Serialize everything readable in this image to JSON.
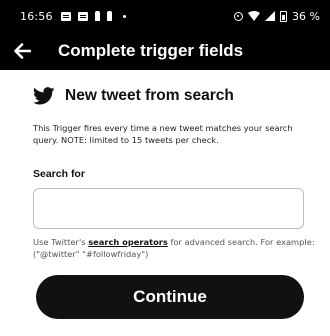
{
  "status_bar": {
    "time": "16:56",
    "battery": "36 %",
    "icons": [
      "message-icon",
      "message-icon",
      "person-icon",
      "person-icon",
      "dot-icon",
      "location-icon",
      "wifi-icon",
      "signal-icon",
      "battery-icon"
    ]
  },
  "app_bar": {
    "back_icon": "arrow-left-icon",
    "title": "Complete trigger fields"
  },
  "trigger": {
    "icon": "twitter-bird-icon",
    "name": "New tweet from search",
    "description": "This Trigger fires every time a new tweet matches your search query. NOTE: limited to 15 tweets per check."
  },
  "search_field": {
    "label": "Search for",
    "value": "",
    "help_prefix": "Use Twitter's ",
    "help_link": "search operators",
    "help_suffix": " for advanced search. For example: (\"@twitter\" \"#followfriday\")"
  },
  "continue_label": "Continue",
  "colors": {
    "header_bg": "#000000",
    "button_bg": "#111111",
    "content_bg": "#ffffff"
  }
}
